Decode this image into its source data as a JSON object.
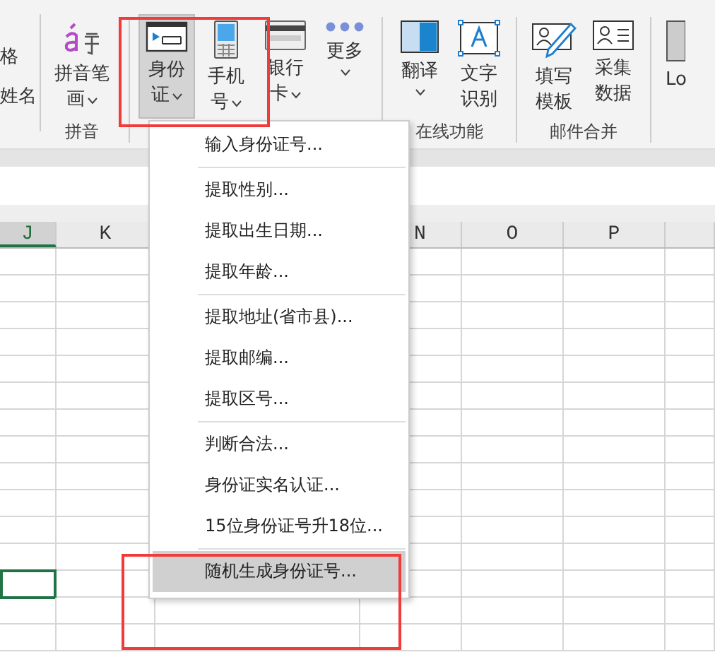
{
  "ribbon": {
    "left_fragments": [
      "格",
      "姓名"
    ],
    "groups": [
      {
        "label": "拼音",
        "buttons": [
          {
            "kind": "pinyin",
            "lines": [
              "拼音笔",
              "画"
            ],
            "dropdown": true,
            "selected": false
          }
        ]
      },
      {
        "buttons": [
          {
            "kind": "idcard",
            "lines": [
              "身份",
              "证"
            ],
            "dropdown": true,
            "selected": true
          },
          {
            "kind": "phone",
            "lines": [
              "手机",
              "号"
            ],
            "dropdown": true,
            "selected": false
          },
          {
            "kind": "bankcard",
            "lines": [
              "银行",
              "卡"
            ],
            "dropdown": true,
            "selected": false
          },
          {
            "kind": "more",
            "lines": [
              "更多"
            ],
            "dropdown": true,
            "selected": false
          }
        ]
      },
      {
        "label": "在线功能",
        "buttons": [
          {
            "kind": "translate",
            "lines": [
              "翻译"
            ],
            "dropdown": true,
            "selected": false
          },
          {
            "kind": "ocr",
            "lines": [
              "文字",
              "识别"
            ],
            "dropdown": false,
            "selected": false
          }
        ]
      },
      {
        "label": "邮件合并",
        "buttons": [
          {
            "kind": "template",
            "lines": [
              "填写",
              "模板"
            ],
            "dropdown": false,
            "selected": false
          },
          {
            "kind": "collect",
            "lines": [
              "采集",
              "数据"
            ],
            "dropdown": false,
            "selected": false
          }
        ]
      },
      {
        "buttons": [
          {
            "kind": "partial",
            "lines": [
              "Lo"
            ],
            "dropdown": false,
            "selected": false
          }
        ]
      }
    ]
  },
  "menu": {
    "sections": [
      [
        {
          "label": "输入身份证号...",
          "highlighted": false
        }
      ],
      [
        {
          "label": "提取性别...",
          "highlighted": false
        },
        {
          "label": "提取出生日期...",
          "highlighted": false
        },
        {
          "label": "提取年龄...",
          "highlighted": false
        }
      ],
      [
        {
          "label": "提取地址(省市县)...",
          "highlighted": false
        },
        {
          "label": "提取邮编...",
          "highlighted": false
        },
        {
          "label": "提取区号...",
          "highlighted": false
        }
      ],
      [
        {
          "label": "判断合法...",
          "highlighted": false
        },
        {
          "label": "身份证实名认证...",
          "highlighted": false
        },
        {
          "label": "15位身份证号升18位...",
          "highlighted": false
        }
      ],
      [
        {
          "label": "随机生成身份证号...",
          "highlighted": true
        }
      ]
    ]
  },
  "sheet": {
    "columns": [
      {
        "label": "J",
        "selected": true
      },
      {
        "label": "K",
        "selected": false
      },
      {
        "label": "N",
        "selected": false
      },
      {
        "label": "O",
        "selected": false
      },
      {
        "label": "P",
        "selected": false
      }
    ],
    "rows": [
      {
        "selected": false
      },
      {
        "selected": false
      },
      {
        "selected": false
      },
      {
        "selected": false
      },
      {
        "selected": false
      },
      {
        "selected": false
      },
      {
        "selected": false
      },
      {
        "selected": false
      },
      {
        "selected": false
      },
      {
        "selected": false
      },
      {
        "selected": false
      },
      {
        "selected": false
      },
      {
        "selected": true
      },
      {
        "selected": false
      },
      {
        "selected": false
      }
    ]
  }
}
